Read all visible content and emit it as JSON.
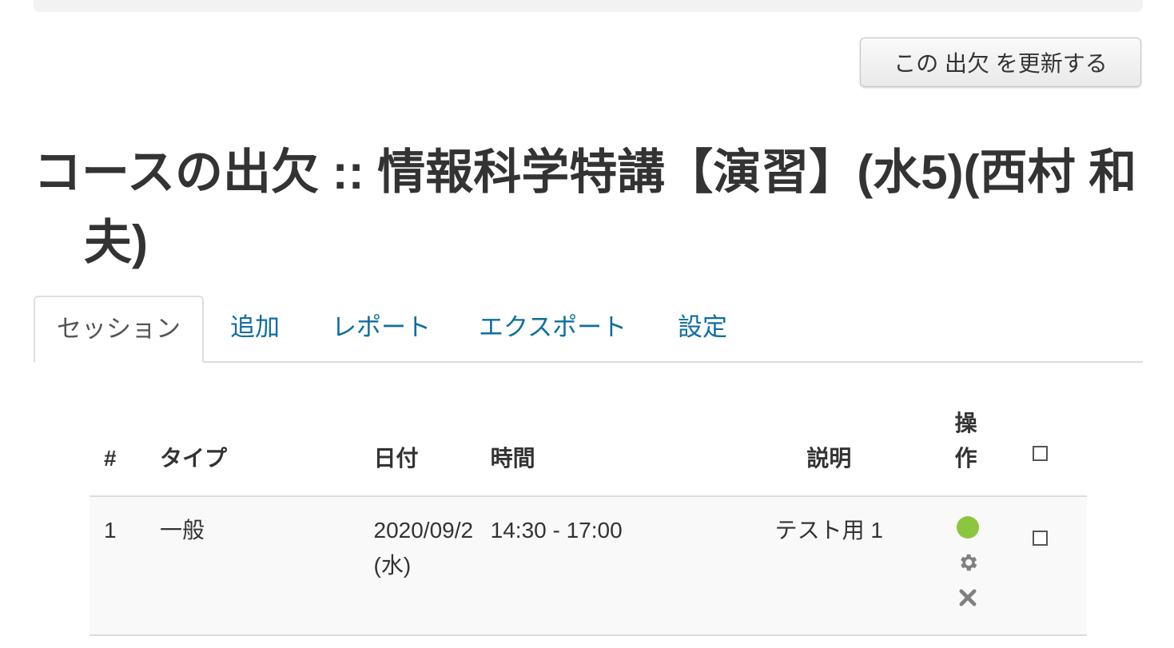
{
  "toolbar": {
    "update_button_label": "この 出欠 を更新する"
  },
  "page": {
    "title": "コースの出欠 :: 情報科学特講【演習】(水5)(西村 和夫)"
  },
  "tabs": [
    {
      "label": "セッション",
      "active": true
    },
    {
      "label": "追加",
      "active": false
    },
    {
      "label": "レポート",
      "active": false
    },
    {
      "label": "エクスポート",
      "active": false
    },
    {
      "label": "設定",
      "active": false
    }
  ],
  "table": {
    "headers": {
      "num": "#",
      "type": "タイプ",
      "date": "日付",
      "time": "時間",
      "description": "説明",
      "actions": "操作"
    },
    "rows": [
      {
        "num": "1",
        "type": "一般",
        "date": "2020/09/2 (水)",
        "time": "14:30 - 17:00",
        "description": "テスト用 1",
        "action_icons": [
          "take-attendance-icon",
          "settings-gear-icon",
          "delete-x-icon"
        ]
      }
    ]
  },
  "colors": {
    "link": "#0f6e9f",
    "status_green": "#8cc63f",
    "icon_gray": "#808080"
  }
}
